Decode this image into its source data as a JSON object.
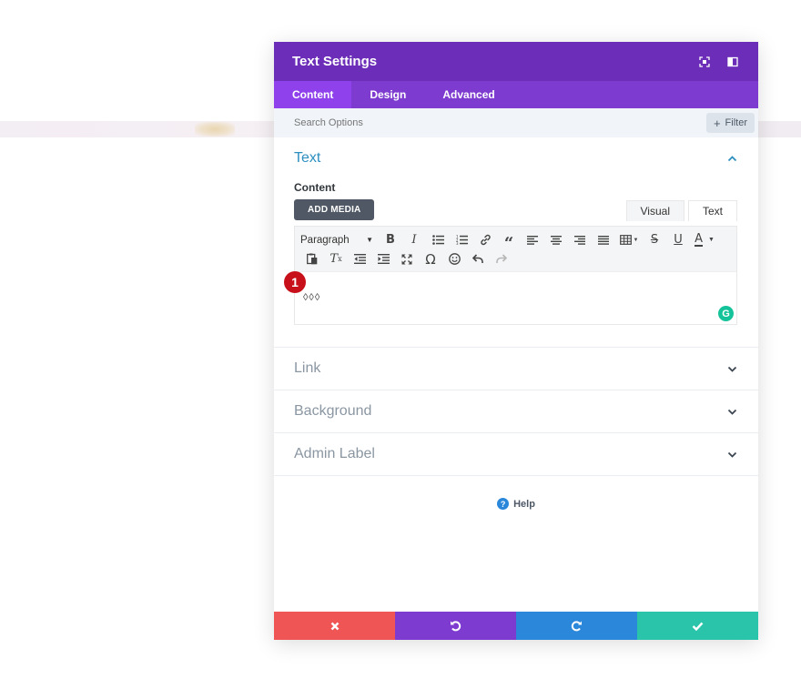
{
  "modal": {
    "title": "Text Settings",
    "header_icons": [
      "expand-icon",
      "sidebar-icon"
    ]
  },
  "tabs": [
    {
      "label": "Content",
      "active": true
    },
    {
      "label": "Design",
      "active": false
    },
    {
      "label": "Advanced",
      "active": false
    }
  ],
  "search": {
    "placeholder": "Search Options",
    "filter_label": "Filter"
  },
  "text_section": {
    "title": "Text",
    "content_label": "Content",
    "add_media_label": "ADD MEDIA",
    "editor_tabs": {
      "visual": "Visual",
      "text": "Text"
    },
    "format_select": "Paragraph",
    "editor_content": "◊◊◊",
    "marker_number": "1"
  },
  "collapsed_sections": [
    {
      "title": "Link"
    },
    {
      "title": "Background"
    },
    {
      "title": "Admin Label"
    }
  ],
  "help_label": "Help",
  "colors": {
    "header": "#6c2eb9",
    "tabs": "#7e3bd0",
    "active_tab": "#8f42ec",
    "accent_text": "#2c8fc0",
    "cancel": "#ef5555",
    "undo": "#7e3bd0",
    "redo": "#2b87da",
    "save": "#29c4a9",
    "marker": "#c8101b"
  }
}
